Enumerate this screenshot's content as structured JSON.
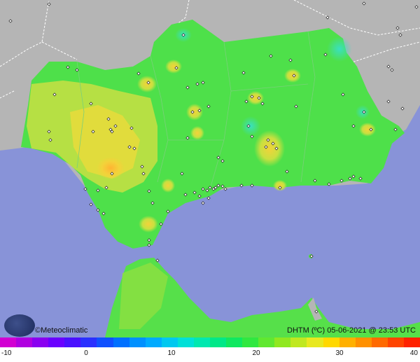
{
  "brand": {
    "name": "©Meteoclimatic",
    "logo_icon": "meteoclimatic-logo-icon"
  },
  "map_title": {
    "variable": "DHTM (ºC)",
    "date": "05-06-2021",
    "time": "23:53 UTC"
  },
  "legend": {
    "ticks": [
      "-10",
      "0",
      "10",
      "20",
      "30",
      "40"
    ],
    "colors": [
      "#d200d2",
      "#b000e0",
      "#8a00f0",
      "#6a00ff",
      "#4a10ff",
      "#2a30ff",
      "#1050ff",
      "#0070ff",
      "#0090ff",
      "#00aaff",
      "#00c8f0",
      "#00e0d8",
      "#00e8b0",
      "#00e888",
      "#10e860",
      "#30e840",
      "#60e830",
      "#90e820",
      "#c0e820",
      "#e8e820",
      "#ffd800",
      "#ffb000",
      "#ff9000",
      "#ff6a00",
      "#ff4400",
      "#ff2200"
    ]
  },
  "colors": {
    "sea": "#8893d8",
    "land_outside": "#b5b5b5",
    "region_base": "#4ee04a"
  }
}
